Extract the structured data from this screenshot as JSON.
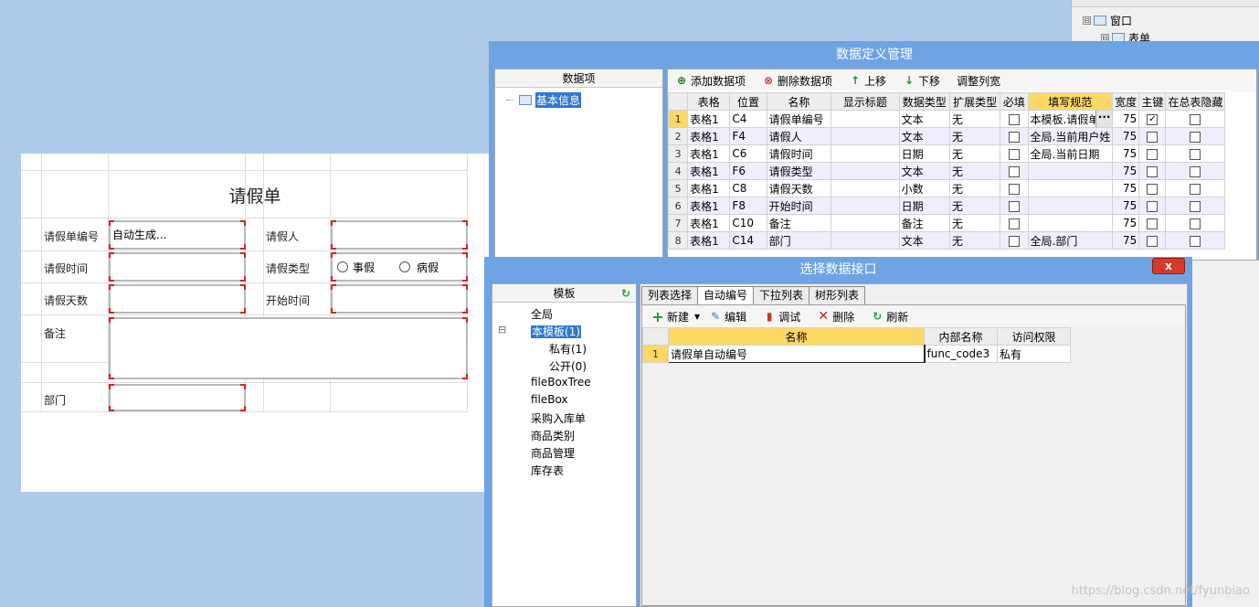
{
  "right_tree": {
    "items": [
      {
        "label": "窗口",
        "toggle": "⊟"
      },
      {
        "label": "表单",
        "toggle": "⊟"
      }
    ]
  },
  "form": {
    "title": "请假单",
    "labels": {
      "leave_no": "请假单编号",
      "applicant": "请假人",
      "leave_time": "请假时间",
      "leave_type": "请假类型",
      "leave_days": "请假天数",
      "start_time": "开始时间",
      "remark": "备注",
      "department": "部门"
    },
    "leave_no_value": "自动生成...",
    "leave_type_options": [
      "事假",
      "病假"
    ]
  },
  "data_def": {
    "title": "数据定义管理",
    "left_header": "数据项",
    "tree_item": "基本信息",
    "toolbar": {
      "add": "添加数据项",
      "delete": "删除数据项",
      "up": "上移",
      "down": "下移",
      "adjust": "调整列宽"
    },
    "columns": [
      "表格",
      "位置",
      "名称",
      "显示标题",
      "数据类型",
      "扩展类型",
      "必填",
      "填写规范",
      "宽度",
      "主键",
      "在总表隐藏"
    ],
    "rows": [
      {
        "n": "1",
        "table": "表格1",
        "pos": "C4",
        "name": "请假单编号",
        "disp": "",
        "dtype": "文本",
        "ext": "无",
        "required": false,
        "rule": "本模板.请假单",
        "width": "75",
        "pk": true,
        "hide": false
      },
      {
        "n": "2",
        "table": "表格1",
        "pos": "F4",
        "name": "请假人",
        "disp": "",
        "dtype": "文本",
        "ext": "无",
        "required": false,
        "rule": "全局.当前用户姓",
        "width": "75",
        "pk": false,
        "hide": false
      },
      {
        "n": "3",
        "table": "表格1",
        "pos": "C6",
        "name": "请假时间",
        "disp": "",
        "dtype": "日期",
        "ext": "无",
        "required": false,
        "rule": "全局.当前日期",
        "width": "75",
        "pk": false,
        "hide": false
      },
      {
        "n": "4",
        "table": "表格1",
        "pos": "F6",
        "name": "请假类型",
        "disp": "",
        "dtype": "文本",
        "ext": "无",
        "required": false,
        "rule": "",
        "width": "75",
        "pk": false,
        "hide": false
      },
      {
        "n": "5",
        "table": "表格1",
        "pos": "C8",
        "name": "请假天数",
        "disp": "",
        "dtype": "小数",
        "ext": "无",
        "required": false,
        "rule": "",
        "width": "75",
        "pk": false,
        "hide": false
      },
      {
        "n": "6",
        "table": "表格1",
        "pos": "F8",
        "name": "开始时间",
        "disp": "",
        "dtype": "日期",
        "ext": "无",
        "required": false,
        "rule": "",
        "width": "75",
        "pk": false,
        "hide": false
      },
      {
        "n": "7",
        "table": "表格1",
        "pos": "C10",
        "name": "备注",
        "disp": "",
        "dtype": "备注",
        "ext": "无",
        "required": false,
        "rule": "",
        "width": "75",
        "pk": false,
        "hide": false
      },
      {
        "n": "8",
        "table": "表格1",
        "pos": "C14",
        "name": "部门",
        "disp": "",
        "dtype": "文本",
        "ext": "无",
        "required": false,
        "rule": "全局.部门",
        "width": "75",
        "pk": false,
        "hide": false
      }
    ],
    "ellipsis": "···"
  },
  "select_iface": {
    "title": "选择数据接口",
    "close": "x",
    "left_header": "模板",
    "templates": [
      {
        "label": "全局",
        "indent": 0
      },
      {
        "label": "本模板(1)",
        "indent": 0,
        "selected": true,
        "toggle": "⊟"
      },
      {
        "label": "私有(1)",
        "indent": 1
      },
      {
        "label": "公开(0)",
        "indent": 1
      },
      {
        "label": "fileBoxTree",
        "indent": 0
      },
      {
        "label": "fileBox",
        "indent": 0
      },
      {
        "label": "采购入库单",
        "indent": 0
      },
      {
        "label": "商品类别",
        "indent": 0
      },
      {
        "label": "商品管理",
        "indent": 0
      },
      {
        "label": "库存表",
        "indent": 0
      }
    ],
    "tabs": [
      "列表选择",
      "自动编号",
      "下拉列表",
      "树形列表"
    ],
    "active_tab": "自动编号",
    "toolbar": {
      "new": "新建",
      "edit": "编辑",
      "debug": "调试",
      "delete": "删除",
      "refresh": "刷新"
    },
    "columns": [
      "名称",
      "内部名称",
      "访问权限"
    ],
    "rows": [
      {
        "n": "1",
        "name": "请假单自动编号",
        "internal": "func_code3",
        "access": "私有"
      }
    ]
  },
  "watermark": "https://blog.csdn.net/fyunbiao",
  "colors": {
    "background": "#aecbea",
    "window_title": "#6ea3e4",
    "header_highlight": "#fdd865",
    "selection": "#2f78d6",
    "close_button": "#d43a2c"
  }
}
